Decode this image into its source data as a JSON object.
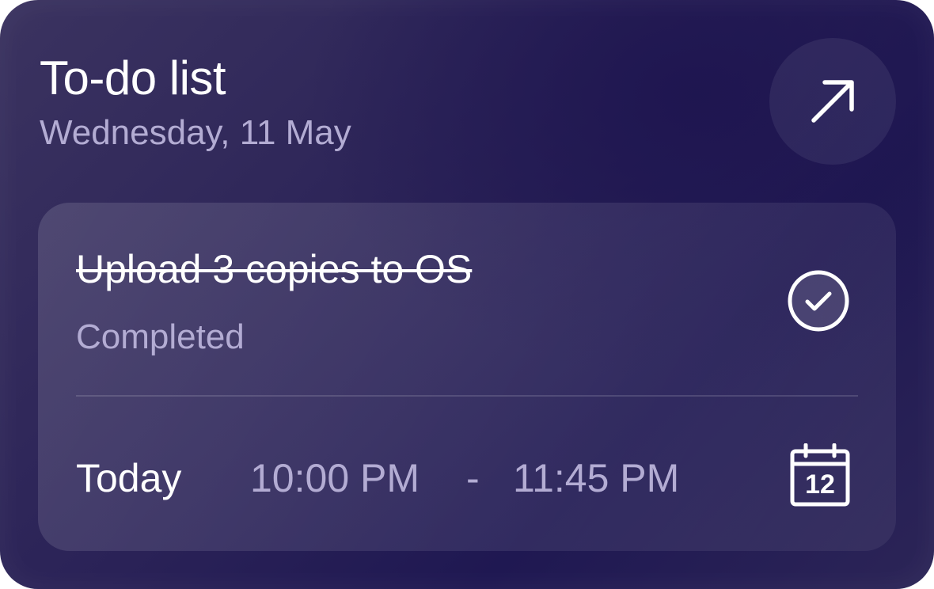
{
  "widget": {
    "title": "To-do list",
    "date": "Wednesday, 11 May",
    "open_icon": "arrow-up-right-icon"
  },
  "task": {
    "title": "Upload 3 copies to OS",
    "status": "Completed",
    "status_icon": "check-circle-icon",
    "day": "Today",
    "start_time": "10:00 PM",
    "separator": "-",
    "end_time": "11:45 PM",
    "calendar_icon": "calendar-icon",
    "calendar_day": "12"
  },
  "colors": {
    "background": "#241d55",
    "text_primary": "#ffffff",
    "text_secondary": "#b3acd3"
  }
}
